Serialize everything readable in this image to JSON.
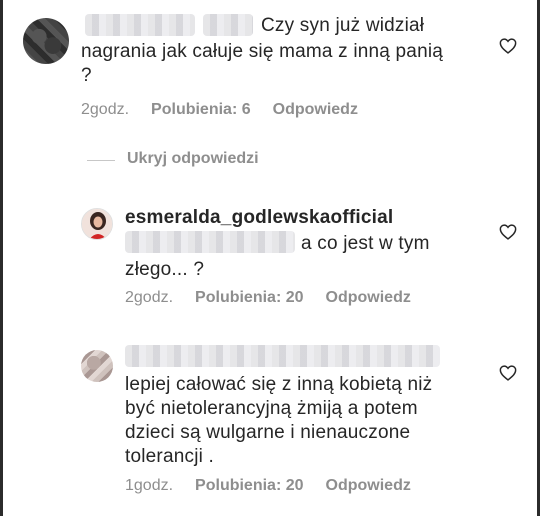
{
  "comments": [
    {
      "text_line1": "Czy syn już widział",
      "text_rest": "nagrania jak całuje się mama z inną panią\n?",
      "time": "2godz.",
      "likes": "Polubienia: 6",
      "reply": "Odpowiedz"
    },
    {
      "username": "esmeralda_godlewskaofficial",
      "text_line1": "a co jest w tym",
      "text_rest": "złego... ?",
      "time": "2godz.",
      "likes": "Polubienia: 20",
      "reply": "Odpowiedz"
    },
    {
      "text": "lepiej całować się z inną kobietą niż\nbyć nietolerancyjną żmiją a potem\ndzieci są wulgarne i nienauczone\ntolerancji .",
      "time": "1godz.",
      "likes": "Polubienia: 20",
      "reply": "Odpowiedz"
    }
  ],
  "hide_replies": "Ukryj odpowiedzi",
  "icons": {
    "like": "heart-outline-icon"
  }
}
